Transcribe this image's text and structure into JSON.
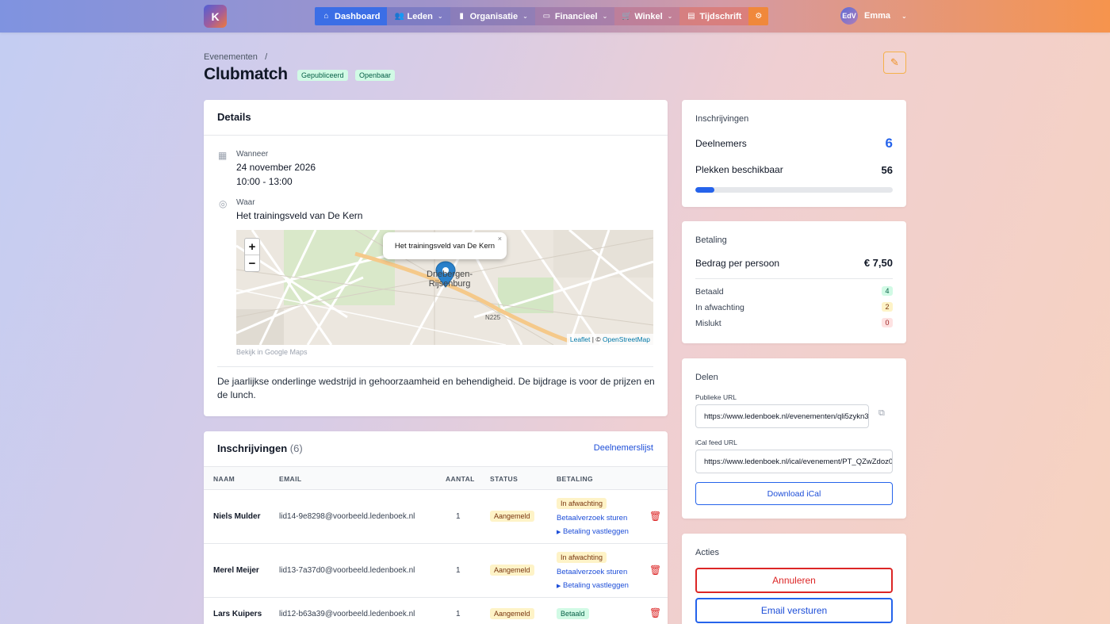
{
  "nav": {
    "logo": "K",
    "items": [
      {
        "label": "Dashboard",
        "icon": "home-icon",
        "active": true
      },
      {
        "label": "Leden",
        "icon": "users-icon",
        "dropdown": true
      },
      {
        "label": "Organisatie",
        "icon": "building-icon",
        "dropdown": true
      },
      {
        "label": "Financieel",
        "icon": "money-icon",
        "dropdown": true
      },
      {
        "label": "Winkel",
        "icon": "cart-icon",
        "dropdown": true
      },
      {
        "label": "Tijdschrift",
        "icon": "newspaper-icon"
      }
    ],
    "user_initials": "EdV",
    "user_name": "Emma"
  },
  "header": {
    "breadcrumb": "Evenementen",
    "title": "Clubmatch",
    "badges": [
      "Gepubliceerd",
      "Openbaar"
    ]
  },
  "details": {
    "title": "Details",
    "when_label": "Wanneer",
    "date": "24 november 2026",
    "time": "10:00 - 13:00",
    "where_label": "Waar",
    "location": "Het trainingsveld van De Kern",
    "map_popup": "Het trainingsveld van De Kern",
    "map_place_1": "Driebergen-",
    "map_place_2": "Rijsenburg",
    "map_road": "N225",
    "map_attrib_leaflet": "Leaflet",
    "map_attrib_sep": "| ©",
    "map_attrib_osm": "OpenStreetMap",
    "google_maps_link": "Bekijk in Google Maps",
    "description": "De jaarlijkse onderlinge wedstrijd in gehoorzaamheid en behendigheid. De bijdrage is voor de prijzen en de lunch."
  },
  "registrations": {
    "title": "Inschrijvingen",
    "count": "(6)",
    "list_link": "Deelnemerslijst",
    "columns": [
      "NAAM",
      "EMAIL",
      "AANTAL",
      "STATUS",
      "BETALING"
    ],
    "rows": [
      {
        "name": "Niels Mulder",
        "email": "lid14-9e8298@voorbeeld.ledenboek.nl",
        "qty": "1",
        "status": "Aangemeld",
        "payment": "In afwachting",
        "request": "Betaalverzoek sturen",
        "record": "Betaling vastleggen"
      },
      {
        "name": "Merel Meijer",
        "email": "lid13-7a37d0@voorbeeld.ledenboek.nl",
        "qty": "1",
        "status": "Aangemeld",
        "payment": "In afwachting",
        "request": "Betaalverzoek sturen",
        "record": "Betaling vastleggen"
      },
      {
        "name": "Lars Kuipers",
        "email": "lid12-b63a39@voorbeeld.ledenboek.nl",
        "qty": "1",
        "status": "Aangemeld",
        "payment": "Betaald"
      }
    ]
  },
  "summary": {
    "title": "Inschrijvingen",
    "participants_label": "Deelnemers",
    "participants": "6",
    "spots_label": "Plekken beschikbaar",
    "spots": "56",
    "fill_fraction": 0.097
  },
  "payment": {
    "title": "Betaling",
    "amount_label": "Bedrag per persoon",
    "amount": "€ 7,50",
    "paid_label": "Betaald",
    "paid": "4",
    "pending_label": "In afwachting",
    "pending": "2",
    "failed_label": "Mislukt",
    "failed": "0"
  },
  "share": {
    "title": "Delen",
    "public_url_label": "Publieke URL",
    "public_url": "https://www.ledenboek.nl/evenementen/qli5zykn3",
    "ical_label": "iCal feed URL",
    "ical_url": "https://www.ledenboek.nl/ical/evenement/PT_QZwZdoz0",
    "download_label": "Download iCal"
  },
  "actions": {
    "title": "Acties",
    "cancel": "Annuleren",
    "email": "Email versturen"
  },
  "colors": {
    "primary": "#2563eb",
    "danger": "#dc2626",
    "accent": "#f6944d"
  }
}
